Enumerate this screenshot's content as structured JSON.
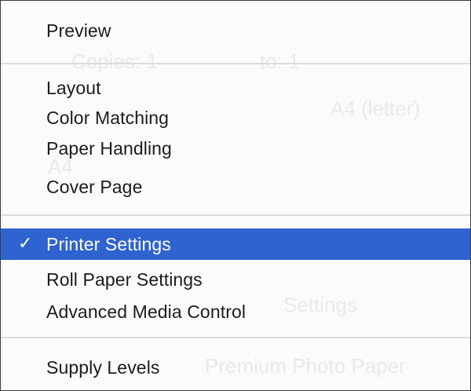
{
  "menu": {
    "items": [
      {
        "label": "Preview"
      },
      {
        "label": "Layout"
      },
      {
        "label": "Color Matching"
      },
      {
        "label": "Paper Handling"
      },
      {
        "label": "Cover Page"
      },
      {
        "label": "Printer Settings",
        "checked": true
      },
      {
        "label": "Roll Paper Settings"
      },
      {
        "label": "Advanced Media Control"
      },
      {
        "label": "Supply Levels"
      }
    ],
    "check_glyph": "✓",
    "selected_color": "#2e63d0"
  }
}
